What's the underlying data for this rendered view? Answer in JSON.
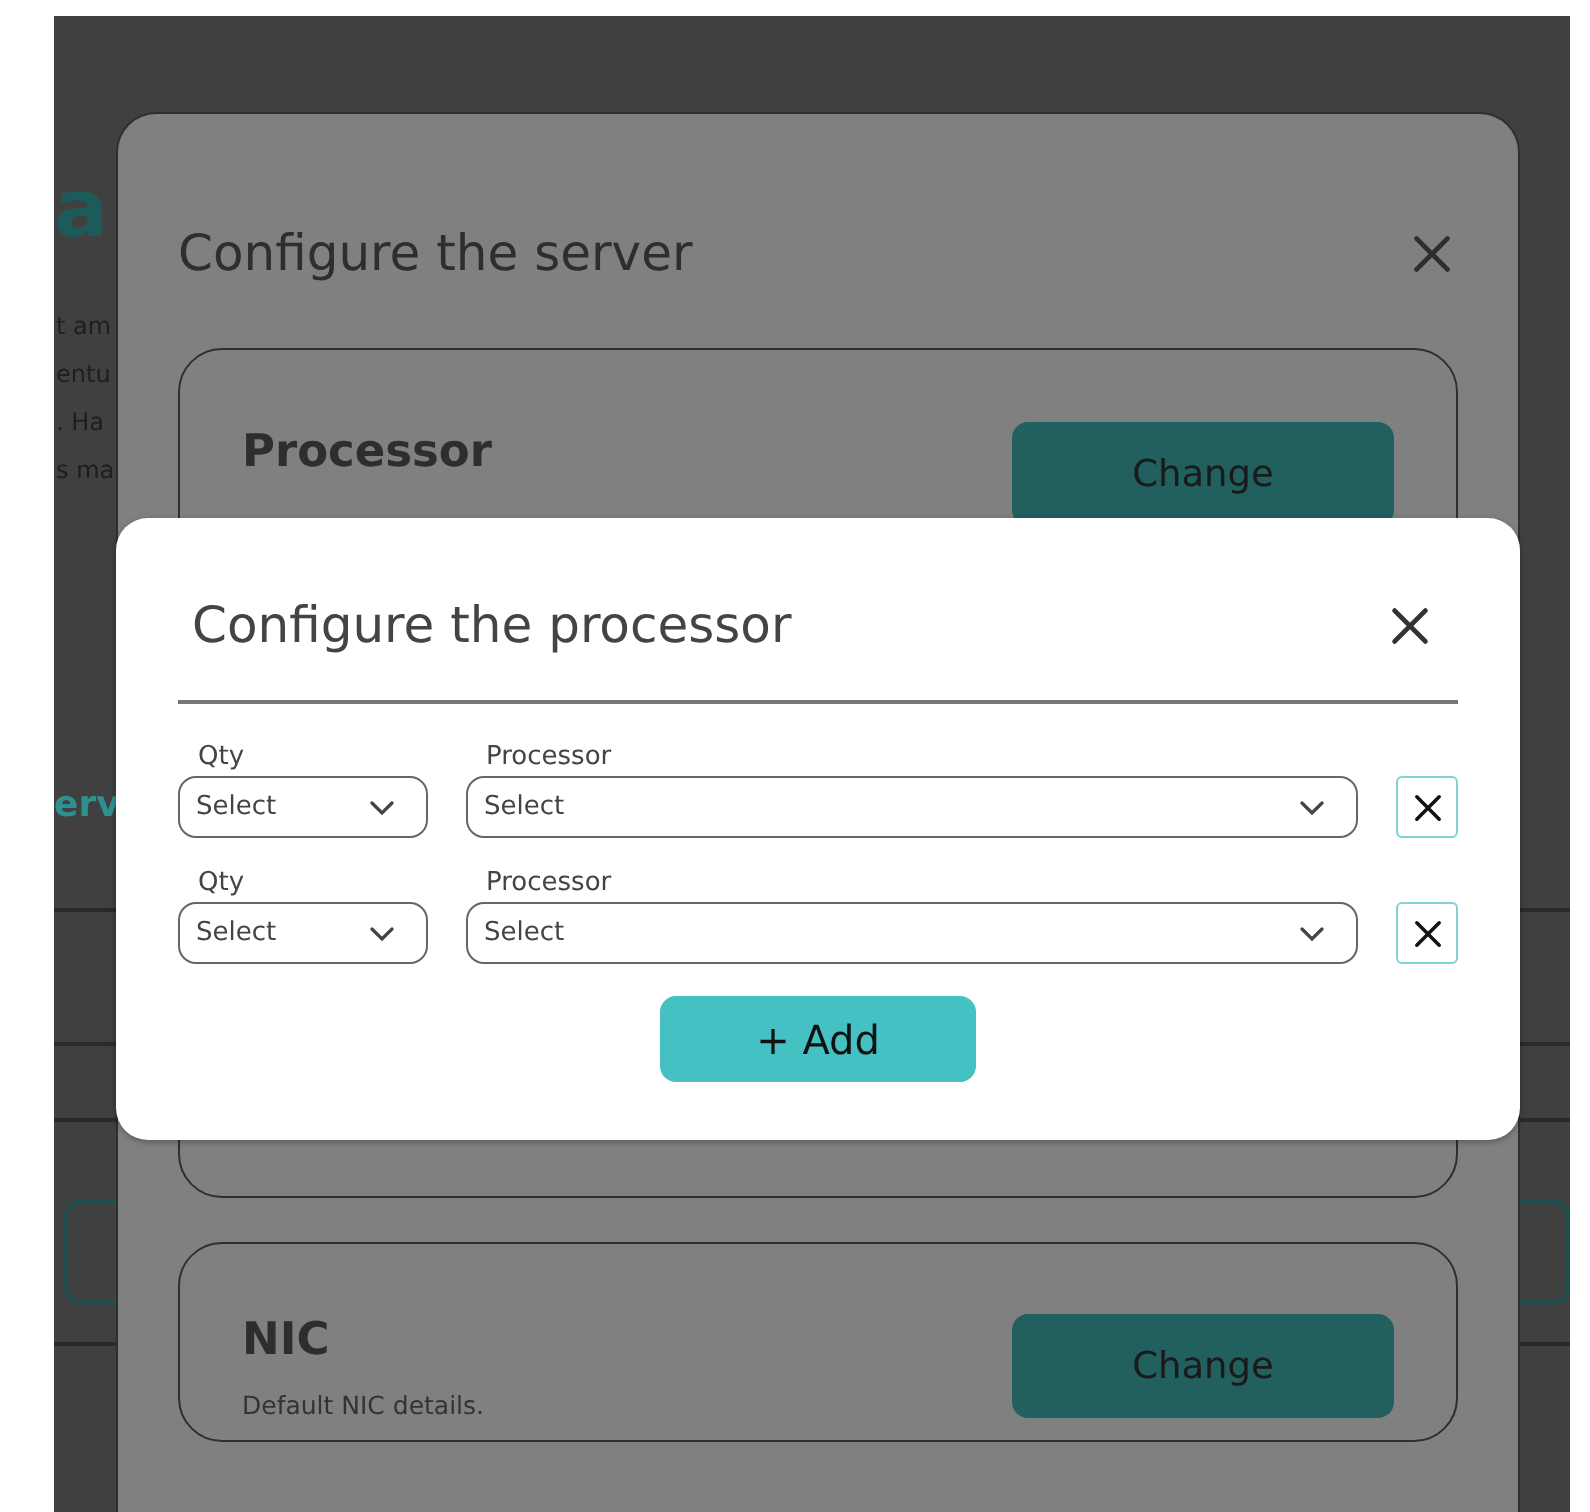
{
  "background_page": {
    "heading": "a",
    "paragraph_lines": [
      "t am",
      "entu",
      ". Ha",
      "s ma"
    ],
    "section_heading": "erv"
  },
  "server_dialog": {
    "title": "Configure the server",
    "sections": [
      {
        "title": "Processor",
        "button": "Change"
      },
      {
        "title": "NIC",
        "description": "Default NIC details.",
        "button": "Change"
      }
    ]
  },
  "processor_dialog": {
    "title": "Configure the processor",
    "rows": [
      {
        "qty_label": "Qty",
        "qty_value": "Select",
        "processor_label": "Processor",
        "processor_value": "Select"
      },
      {
        "qty_label": "Qty",
        "qty_value": "Select",
        "processor_label": "Processor",
        "processor_value": "Select"
      }
    ],
    "add_button": "+ Add"
  }
}
